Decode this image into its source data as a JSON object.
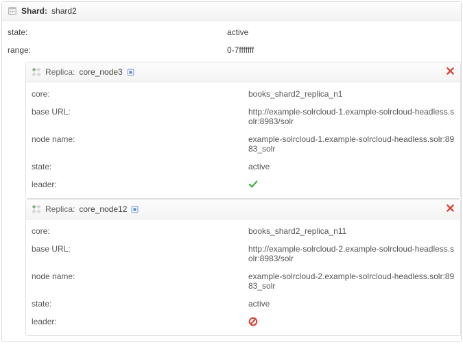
{
  "shard": {
    "header_label": "Shard:",
    "name": "shard2",
    "rows": [
      {
        "key": "state:",
        "value": "active"
      },
      {
        "key": "range:",
        "value": "0-7fffffff"
      }
    ]
  },
  "replicas": [
    {
      "header_label": "Replica:",
      "name": "core_node3",
      "leader": true,
      "rows": [
        {
          "key": "core:",
          "value": "books_shard2_replica_n1"
        },
        {
          "key": "base URL:",
          "value": "http://example-solrcloud-1.example-solrcloud-headless.solr:8983/solr"
        },
        {
          "key": "node name:",
          "value": "example-solrcloud-1.example-solrcloud-headless.solr:8983_solr"
        },
        {
          "key": "state:",
          "value": "active"
        },
        {
          "key": "leader:",
          "value": null,
          "icon": "check"
        }
      ]
    },
    {
      "header_label": "Replica:",
      "name": "core_node12",
      "leader": false,
      "rows": [
        {
          "key": "core:",
          "value": "books_shard2_replica_n11"
        },
        {
          "key": "base URL:",
          "value": "http://example-solrcloud-2.example-solrcloud-headless.solr:8983/solr"
        },
        {
          "key": "node name:",
          "value": "example-solrcloud-2.example-solrcloud-headless.solr:8983_solr"
        },
        {
          "key": "state:",
          "value": "active"
        },
        {
          "key": "leader:",
          "value": null,
          "icon": "forbidden"
        }
      ]
    }
  ]
}
